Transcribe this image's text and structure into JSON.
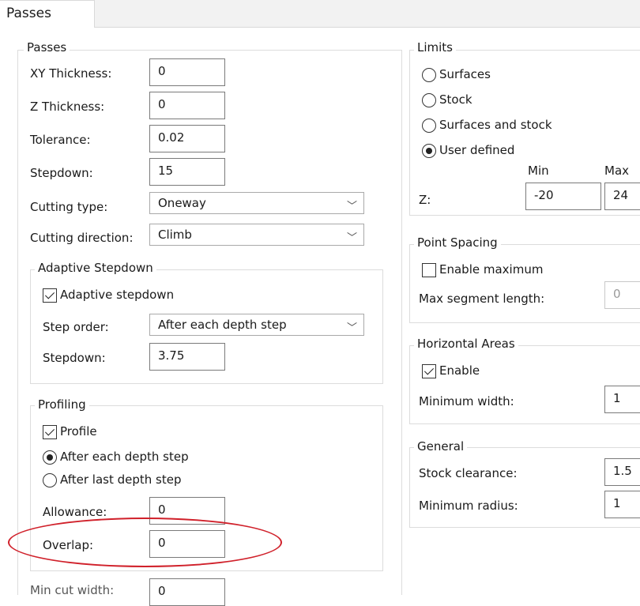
{
  "tab": {
    "label": "Passes"
  },
  "passes": {
    "title": "Passes",
    "xy_thickness": {
      "label": "XY Thickness:",
      "value": "0"
    },
    "z_thickness": {
      "label": "Z Thickness:",
      "value": "0"
    },
    "tolerance": {
      "label": "Tolerance:",
      "value": "0.02"
    },
    "stepdown": {
      "label": "Stepdown:",
      "value": "15"
    },
    "cutting_type": {
      "label": "Cutting type:",
      "value": "Oneway"
    },
    "cutting_direction": {
      "label": "Cutting direction:",
      "value": "Climb"
    },
    "adaptive": {
      "title": "Adaptive Stepdown",
      "checkbox_label": "Adaptive stepdown",
      "checked": true,
      "step_order": {
        "label": "Step order:",
        "value": "After each depth step"
      },
      "stepdown": {
        "label": "Stepdown:",
        "value": "3.75"
      }
    },
    "profiling": {
      "title": "Profiling",
      "profile_label": "Profile",
      "profile_checked": true,
      "radio_after_each": "After each depth step",
      "radio_after_last": "After last depth step",
      "selected": "after_each",
      "allowance": {
        "label": "Allowance:",
        "value": "0"
      },
      "overlap": {
        "label": "Overlap:",
        "value": "0"
      }
    },
    "min_cut_width": {
      "label": "Min cut width:",
      "value": "0"
    }
  },
  "limits": {
    "title": "Limits",
    "options": [
      "Surfaces",
      "Stock",
      "Surfaces and stock",
      "User defined"
    ],
    "selected": "User defined",
    "min_label": "Min",
    "max_label": "Max",
    "z_label": "Z:",
    "z_min": "-20",
    "z_max": "24"
  },
  "point_spacing": {
    "title": "Point Spacing",
    "enable_label": "Enable maximum",
    "enable_checked": false,
    "max_segment": {
      "label": "Max segment length:",
      "value": "0"
    }
  },
  "horizontal_areas": {
    "title": "Horizontal Areas",
    "enable_label": "Enable",
    "enable_checked": true,
    "min_width": {
      "label": "Minimum width:",
      "value": "1"
    }
  },
  "general": {
    "title": "General",
    "stock_clearance": {
      "label": "Stock clearance:",
      "value": "1.5"
    },
    "min_radius": {
      "label": "Minimum radius:",
      "value": "1"
    }
  },
  "colors": {
    "annotation": "#d0202a"
  }
}
